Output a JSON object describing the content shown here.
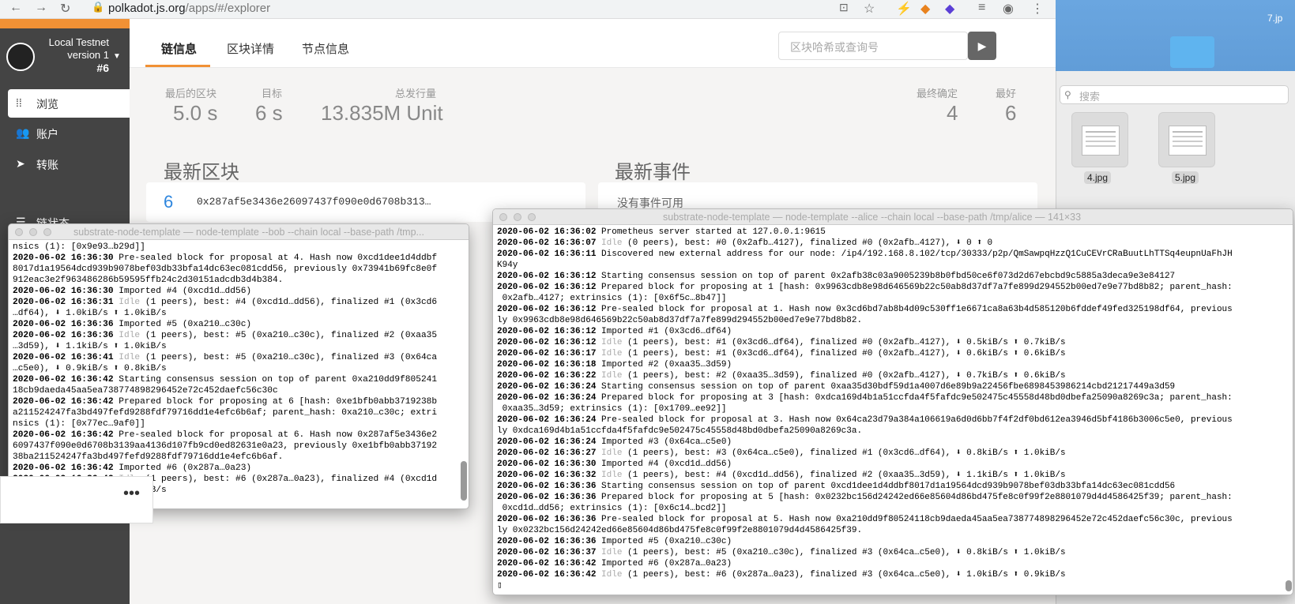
{
  "browser": {
    "url_domain": "polkadot.js.org",
    "url_path": "/apps/#/explorer"
  },
  "desktop": {
    "search_placeholder": "搜索",
    "files": [
      "4.jpg",
      "5.jpg"
    ],
    "edge_label": "7.jp"
  },
  "app": {
    "network_name": "Local Testnet",
    "network_version": "version 1",
    "network_block": "#6",
    "nav": [
      {
        "label": "浏览",
        "icon": "browse-icon"
      },
      {
        "label": "账户",
        "icon": "accounts-icon"
      },
      {
        "label": "转账",
        "icon": "transfer-icon"
      },
      {
        "label": "链状态",
        "icon": "chainstate-icon"
      }
    ],
    "tabs": [
      "链信息",
      "区块详情",
      "节点信息"
    ],
    "search_placeholder": "区块哈希或查询号",
    "stats": {
      "last_block_label": "最后的区块",
      "last_block_value": "5.0 s",
      "target_label": "目标",
      "target_value": "6 s",
      "issuance_label": "总发行量",
      "issuance_value": "13.835M Unit",
      "finalized_label": "最终确定",
      "finalized_value": "4",
      "best_label": "最好",
      "best_value": "6"
    },
    "recent_blocks_title": "最新区块",
    "recent_events_title": "最新事件",
    "block_number": "6",
    "block_hash": "0x287af5e3436e26097437f090e0d6708b313…",
    "no_events": "没有事件可用"
  },
  "bob_terminal": {
    "title": "substrate-node-template — node-template --bob --chain local --base-path /tmp..."
  },
  "alice_terminal": {
    "title": "substrate-node-template — node-template --alice --chain local --base-path /tmp/alice — 141×33"
  },
  "more_menu": "•••"
}
